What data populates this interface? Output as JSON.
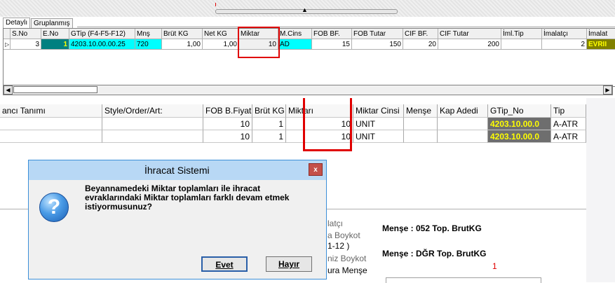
{
  "top_tabs": [
    "Detaylı",
    "Gruplanmış"
  ],
  "grid1": {
    "columns": [
      "S.No",
      "E.No",
      "GTip (F4-F5-F12)",
      "Mnş",
      "Brüt KG",
      "Net KG",
      "Miktar",
      "M.Cins",
      "FOB BF.",
      "FOB Tutar",
      "CIF BF.",
      "CIF Tutar",
      "İml.Tip",
      "İmalatçı",
      "İmalat"
    ],
    "row": {
      "indicator": "▷",
      "s_no": "3",
      "e_no": "1",
      "gtip": "4203.10.00.00.25",
      "mns": "720",
      "brut_kg": "1,00",
      "net_kg": "1,00",
      "miktar": "10",
      "m_cins": "AD",
      "fob_bf": "15",
      "fob_tutar": "150",
      "cif_bf": "20",
      "cif_tutar": "200",
      "iml_tip": "",
      "imalatci": "2",
      "imalat": "EVRII"
    }
  },
  "grid2": {
    "columns": [
      "ancı Tanımı",
      "Style/Order/Art:",
      "FOB B.Fiyatı",
      "Brüt KG",
      "Miktarı",
      "Miktar Cinsi",
      "Menşe",
      "Kap Adedi",
      "GTip_No",
      "Tip"
    ],
    "rows": [
      {
        "tanim": "",
        "style": "",
        "fob": "10",
        "brut": "1",
        "miktar": "10",
        "cinsi": "UNIT",
        "mense": "",
        "kap": "",
        "gtip": "4203.10.00.0",
        "tip": "A-ATR"
      },
      {
        "tanim": "",
        "style": "",
        "fob": "10",
        "brut": "1",
        "miktar": "10",
        "cinsi": "UNIT",
        "mense": "",
        "kap": "",
        "gtip": "4203.10.00.0",
        "tip": "A-ATR"
      }
    ]
  },
  "dialog": {
    "title": "İhracat Sistemi",
    "close_label": "x",
    "icon": "question-icon",
    "message": "Beyannamedeki Miktar toplamları ile ihracat\nevraklarındaki Miktar toplamları farklı devam etmek\nistiyormusunuz?",
    "yes_label": "Evet",
    "no_label": "Hayır"
  },
  "lower": {
    "l1": "latçı",
    "l2": "a Boykot",
    "l3": "1-12 )",
    "l4": "niz Boykot",
    "l5": "ura Menşe",
    "mense1": "Menşe : 052  Top. BrutKG",
    "mense2": "Menşe : DĞR  Top. BrutKG",
    "value": "1"
  },
  "colors": {
    "accent_red": "#e00000",
    "teal": "#008080",
    "cyan": "#00ffff",
    "yellow": "#ffff00",
    "gtip_bg": "#6e6e6e"
  }
}
